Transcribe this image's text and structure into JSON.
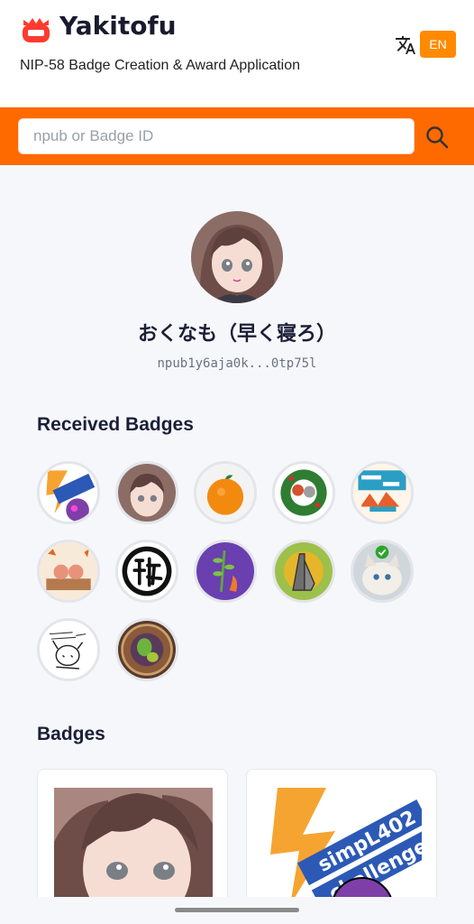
{
  "app": {
    "title": "Yakitofu",
    "subtitle": "NIP-58 Badge Creation & Award Application",
    "language_button": "EN",
    "brand_color": "#ff6a00",
    "accent_color": "#ff8a00"
  },
  "search": {
    "placeholder": "npub or Badge ID",
    "value": ""
  },
  "profile": {
    "name": "おくなも（早く寝ろ）",
    "npub": "npub1y6aja0k...0tp75l"
  },
  "sections": {
    "received_title": "Received Badges",
    "badges_title": "Badges"
  },
  "received_badges": [
    {
      "icon": "simpl-402-challenge-badge"
    },
    {
      "icon": "anime-girl-portrait-badge"
    },
    {
      "icon": "mikan-orange-badge"
    },
    {
      "icon": "christmas-wreath-badge"
    },
    {
      "icon": "nostr-asia-badge"
    },
    {
      "icon": "autumn-characters-badge"
    },
    {
      "icon": "kanji-seal-badge"
    },
    {
      "icon": "purple-plant-badge"
    },
    {
      "icon": "praying-hands-badge"
    },
    {
      "icon": "verified-cat-badge"
    },
    {
      "icon": "sketch-drawing-badge"
    },
    {
      "icon": "kiwi-mandala-badge"
    }
  ],
  "badge_cards": [
    {
      "icon": "anime-girl-portrait-card"
    },
    {
      "icon": "simpl-402-challenge-card"
    }
  ]
}
